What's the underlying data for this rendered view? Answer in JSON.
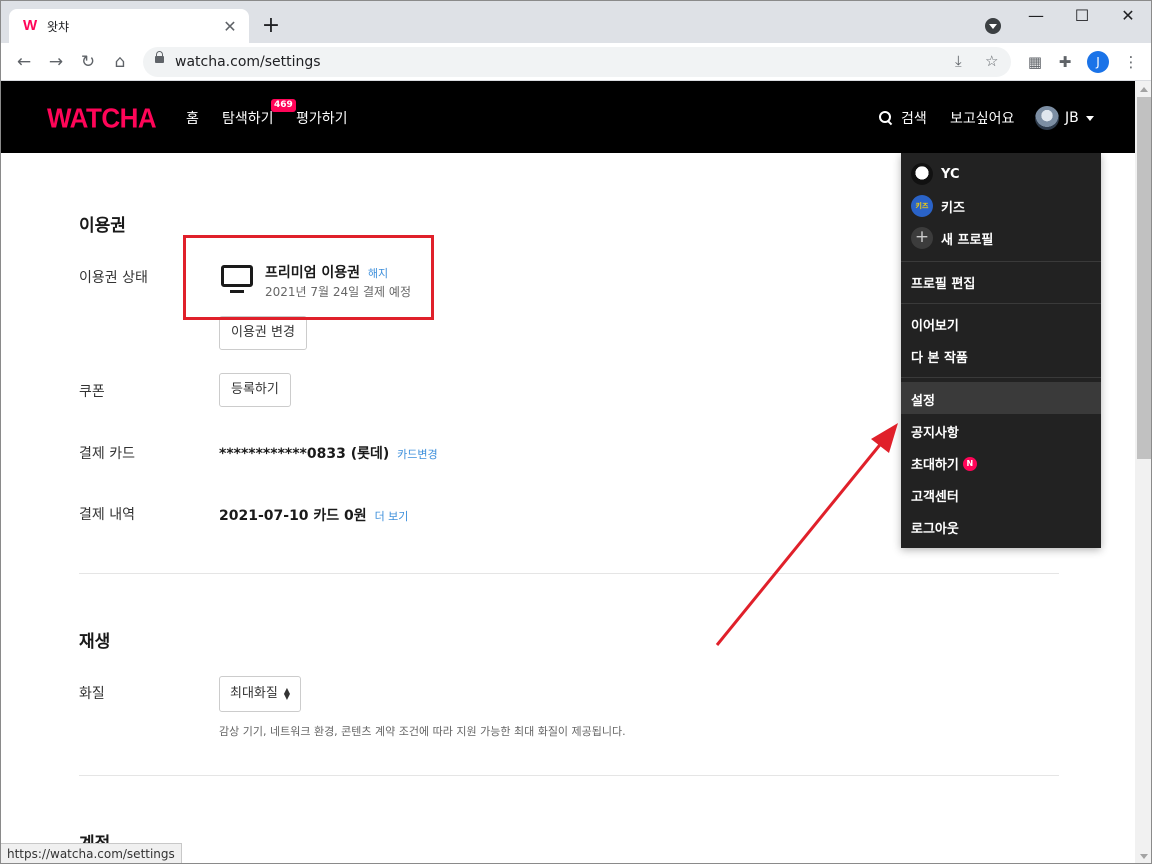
{
  "browser": {
    "tab_title": "왓챠",
    "tab_favicon": "W",
    "url": "watcha.com/settings",
    "profile_initial": "J",
    "status_url": "https://watcha.com/settings"
  },
  "header": {
    "logo": "WATCHA",
    "nav": [
      {
        "label": "홈"
      },
      {
        "label": "탐색하기"
      },
      {
        "label": "평가하기"
      }
    ],
    "explore_badge": "469",
    "search_label": "검색",
    "wishlist_label": "보고싶어요",
    "profile_initials": "JB"
  },
  "membership": {
    "section_title": "이용권",
    "status_label": "이용권 상태",
    "plan_name": "프리미엄 이용권",
    "cancel_link": "해지",
    "payment_date": "2021년 7월 24일 결제 예정",
    "change_button": "이용권 변경",
    "coupon_label": "쿠폰",
    "coupon_button": "등록하기",
    "card_label": "결제 카드",
    "card_value": "************0833 (롯데)",
    "card_change_link": "카드변경",
    "history_label": "결제 내역",
    "history_value": "2021-07-10 카드 0원",
    "history_more_link": "더 보기"
  },
  "playback": {
    "section_title": "재생",
    "quality_label": "화질",
    "quality_selected": "최대화질",
    "quality_hint": "감상 기기, 네트워크 환경, 콘텐츠 계약 조건에 따라 지원 가능한 최대 화질이 제공됩니다."
  },
  "account": {
    "section_title": "계정"
  },
  "menu": {
    "profiles": [
      {
        "name": "YC"
      },
      {
        "name": "키즈",
        "avatar_text": "키즈"
      }
    ],
    "new_profile": "새 프로필",
    "edit_profile": "프로필 편집",
    "continue_watching": "이어보기",
    "watched": "다 본 작품",
    "settings": "설정",
    "notices": "공지사항",
    "invite": "초대하기",
    "invite_badge": "N",
    "support": "고객센터",
    "logout": "로그아웃"
  },
  "colors": {
    "brand": "#ff0558",
    "link": "#3d8fdb",
    "annotation": "#e0202a"
  }
}
